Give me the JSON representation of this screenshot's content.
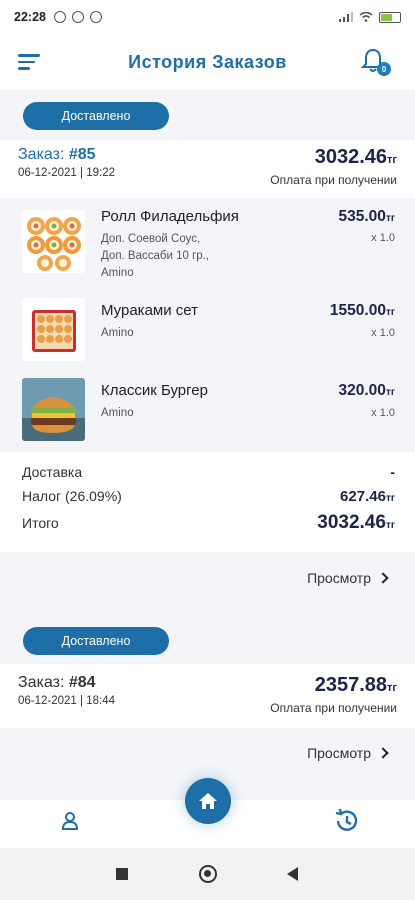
{
  "status_bar": {
    "time": "22:28",
    "battery": "51"
  },
  "header": {
    "title": "История Заказов",
    "notification_count": "0"
  },
  "orders": [
    {
      "status": "Доставлено",
      "label": "Заказ:",
      "number": "#85",
      "date": "06-12-2021 | 19:22",
      "total": "3032.46",
      "currency": "тг",
      "payment": "Оплата при получении",
      "items": [
        {
          "name": "Ролл Филадельфия",
          "options": [
            "Доп. Соевой Соус,",
            "Доп. Вассаби 10 гр.,",
            "Amino"
          ],
          "price": "535.00",
          "currency": "тг",
          "qty": "x 1.0"
        },
        {
          "name": "Мураками сет",
          "options": [
            "Amino"
          ],
          "price": "1550.00",
          "currency": "тг",
          "qty": "x 1.0"
        },
        {
          "name": "Классик Бургер",
          "options": [
            "Amino"
          ],
          "price": "320.00",
          "currency": "тг",
          "qty": "x 1.0"
        }
      ],
      "summary": {
        "delivery_label": "Доставка",
        "delivery_value": "-",
        "tax_label": "Налог (26.09%)",
        "tax_value": "627.46",
        "tax_currency": "тг",
        "total_label": "Итого",
        "total_value": "3032.46",
        "total_currency": "тг"
      },
      "view_label": "Просмотр"
    },
    {
      "status": "Доставлено",
      "label": "Заказ:",
      "number": "#84",
      "date": "06-12-2021 | 18:44",
      "total": "2357.88",
      "currency": "тг",
      "payment": "Оплата при получении",
      "view_label": "Просмотр"
    }
  ],
  "colors": {
    "primary": "#1e6fa8",
    "text_dark": "#1a2548",
    "background": "#f3f5f9"
  }
}
